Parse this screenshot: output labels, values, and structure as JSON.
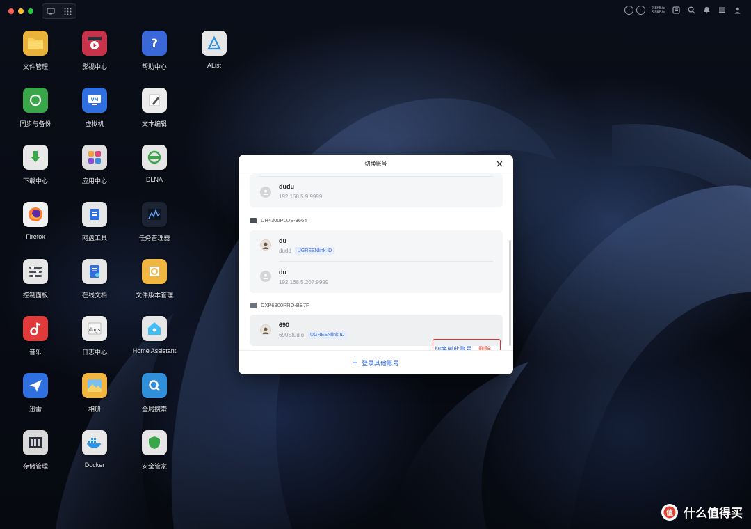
{
  "topbar": {
    "net_up": "↑ 2.8KB/s",
    "net_down": "↓ 3.8KB/s",
    "ram_label": "RAM"
  },
  "desktop": {
    "apps": [
      {
        "label": "文件管理",
        "icon": "folder-icon",
        "color": "#e9b23a"
      },
      {
        "label": "同步与备份",
        "icon": "sync-icon",
        "color": "#3aa64a"
      },
      {
        "label": "下载中心",
        "icon": "download-icon",
        "color": "#e8e8e8"
      },
      {
        "label": "Firefox",
        "icon": "firefox-icon",
        "color": "#f2f2f2"
      },
      {
        "label": "控制面板",
        "icon": "control-panel-icon",
        "color": "#e6e6e6"
      },
      {
        "label": "音乐",
        "icon": "music-icon",
        "color": "#e03a3a"
      },
      {
        "label": "迅雷",
        "icon": "thunder-bird-icon",
        "color": "#2f6fe0"
      },
      {
        "label": "存储管理",
        "icon": "storage-icon",
        "color": "#d9d9d9"
      },
      {
        "label": "影视中心",
        "icon": "video-icon",
        "color": "#c8324a"
      },
      {
        "label": "虚拟机",
        "icon": "vm-icon",
        "color": "#2f6fe0"
      },
      {
        "label": "应用中心",
        "icon": "app-center-icon",
        "color": "#e0e0e0"
      },
      {
        "label": "网盘工具",
        "icon": "cloud-drive-icon",
        "color": "#e6e6e6"
      },
      {
        "label": "在线文档",
        "icon": "online-doc-icon",
        "color": "#e6e6e6"
      },
      {
        "label": "日志中心",
        "icon": "logs-icon",
        "color": "#ededed"
      },
      {
        "label": "相册",
        "icon": "photos-icon",
        "color": "#f0b640"
      },
      {
        "label": "Docker",
        "icon": "docker-icon",
        "color": "#e8e8e8"
      },
      {
        "label": "帮助中心",
        "icon": "help-icon",
        "color": "#3a68d8"
      },
      {
        "label": "文本编辑",
        "icon": "text-editor-icon",
        "color": "#ececec"
      },
      {
        "label": "DLNA",
        "icon": "dlna-icon",
        "color": "#e6e6e6"
      },
      {
        "label": "任务管理器",
        "icon": "task-manager-icon",
        "color": "#1c2433"
      },
      {
        "label": "文件版本管理",
        "icon": "file-version-icon",
        "color": "#f0b640"
      },
      {
        "label": "Home Assistant",
        "icon": "home-assistant-icon",
        "color": "#e6e6e6"
      },
      {
        "label": "全局搜索",
        "icon": "global-search-icon",
        "color": "#2f8fd8"
      },
      {
        "label": "安全管家",
        "icon": "security-shield-icon",
        "color": "#e6e6e6"
      },
      {
        "label": "AList",
        "icon": "alist-icon",
        "color": "#e6e6e6"
      }
    ]
  },
  "modal": {
    "title": "切换账号",
    "groups": [
      {
        "device": "",
        "accounts": [
          {
            "name": "dudu",
            "sub": "192.168.5.9:9999",
            "badge": ""
          }
        ]
      },
      {
        "device": "DH4300PLUS-3664",
        "accounts": [
          {
            "name": "du",
            "sub": "dudd",
            "badge": "UGREENlink ID"
          },
          {
            "name": "du",
            "sub": "192.168.5.207:9999",
            "badge": ""
          }
        ]
      },
      {
        "device": "DXP6800PRO-BB7F",
        "accounts": [
          {
            "name": "690",
            "sub": "690Studio",
            "badge": "UGREENlink ID"
          }
        ]
      }
    ],
    "actions": {
      "switch": "切换到此账号",
      "delete": "删除"
    },
    "footer": {
      "plus": "+",
      "label": "登录其他账号"
    }
  },
  "watermark": {
    "text": "什么值得买",
    "logo": "值"
  },
  "colors": {
    "accent": "#2a62d8",
    "danger": "#e8412f",
    "highlight_box": "#e02f2f"
  }
}
